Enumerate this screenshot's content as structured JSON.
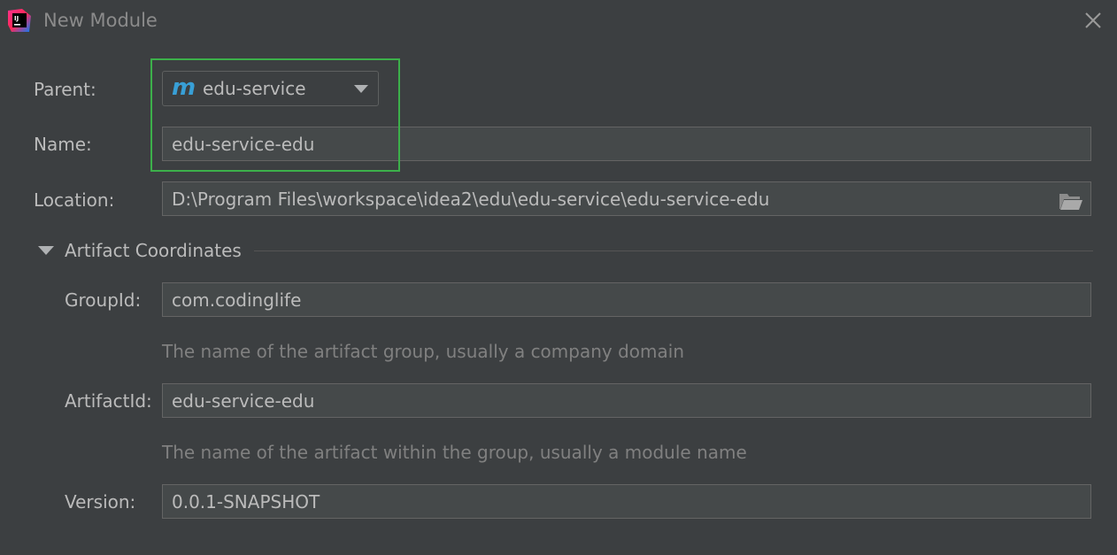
{
  "window": {
    "title": "New Module",
    "app_icon": "intellij-idea-icon",
    "close_icon": "close-icon"
  },
  "form": {
    "parent_label": "Parent:",
    "parent_value": "edu-service",
    "parent_icon": "maven-module-icon",
    "name_label": "Name:",
    "name_value": "edu-service-edu",
    "location_label": "Location:",
    "location_value": "D:\\Program Files\\workspace\\idea2\\edu\\edu-service\\edu-service-edu",
    "browse_icon": "folder-icon"
  },
  "artifact": {
    "section_title": "Artifact Coordinates",
    "expanded": true,
    "groupid_label": "GroupId:",
    "groupid_value": "com.codinglife",
    "groupid_hint": "The name of the artifact group, usually a company domain",
    "artifactid_label": "ArtifactId:",
    "artifactid_value": "edu-service-edu",
    "artifactid_hint": "The name of the artifact within the group, usually a module name",
    "version_label": "Version:",
    "version_value": "0.0.1-SNAPSHOT"
  },
  "colors": {
    "background": "#3c3f41",
    "field_bg": "#45494a",
    "text": "#bbbbbb",
    "hint_text": "#808080",
    "highlight_box": "#3cb04a",
    "maven_icon": "#389fd6"
  }
}
